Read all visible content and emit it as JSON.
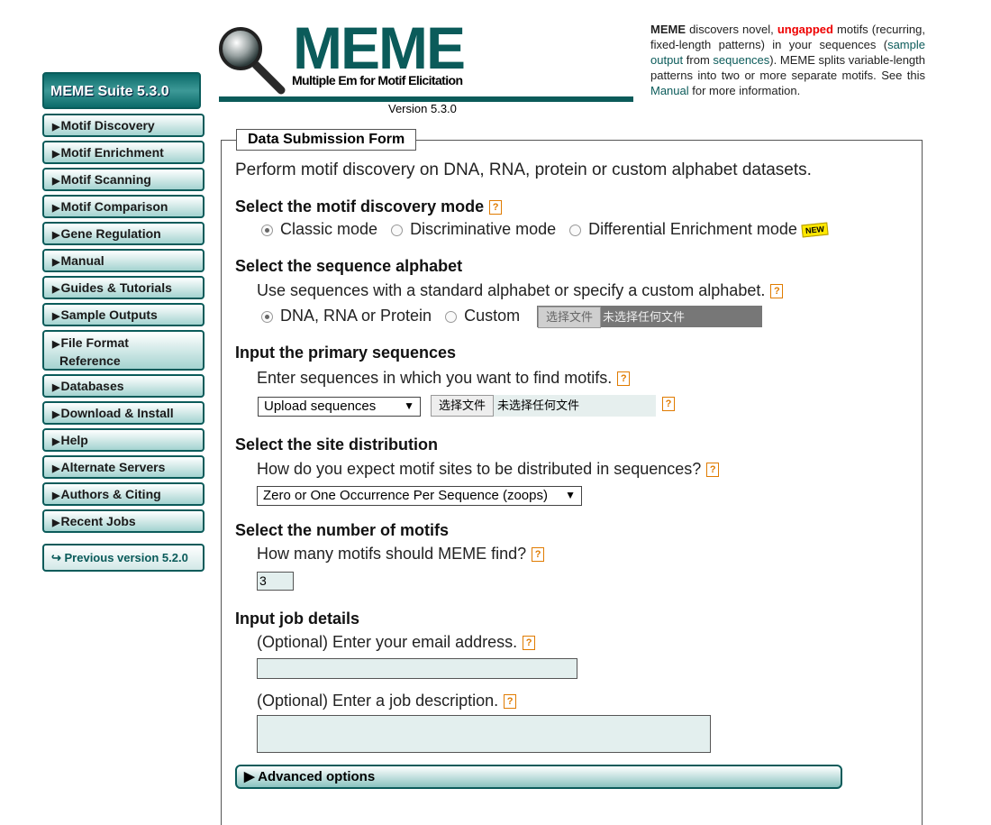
{
  "suite": {
    "label": "MEME Suite 5.3.0"
  },
  "nav": {
    "items": [
      "Motif Discovery",
      "Motif Enrichment",
      "Motif Scanning",
      "Motif Comparison",
      "Gene Regulation",
      "Manual",
      "Guides & Tutorials",
      "Sample Outputs",
      "File Format",
      "Reference",
      "Databases",
      "Download & Install",
      "Help",
      "Alternate Servers",
      "Authors & Citing",
      "Recent Jobs"
    ],
    "previous": "↪ Previous version 5.2.0"
  },
  "header": {
    "logo_title": "MEME",
    "logo_subtitle": "Multiple Em for Motif Elicitation",
    "version": "Version 5.3.0"
  },
  "intro": {
    "p1": "MEME",
    "p2": " discovers novel, ",
    "p3": "ungapped",
    "p4": " motifs (recurring, fixed-length patterns) in your sequences (",
    "link1": "sample output",
    "p5": " from ",
    "link2": "sequences",
    "p6": "). MEME splits variable-length patterns into two or more separate motifs. See this ",
    "link3": "Manual",
    "p7": " for more information."
  },
  "form": {
    "legend": "Data Submission Form",
    "lead": "Perform motif discovery on DNA, RNA, protein or custom alphabet datasets.",
    "mode": {
      "heading": "Select the motif discovery mode",
      "options": [
        "Classic mode",
        "Discriminative mode",
        "Differential Enrichment mode"
      ],
      "selected": "Classic mode",
      "new_badge": "NEW"
    },
    "alphabet": {
      "heading": "Select the sequence alphabet",
      "prompt": "Use sequences with a standard alphabet or specify a custom alphabet.",
      "options": [
        "DNA, RNA or Protein",
        "Custom"
      ],
      "selected": "DNA, RNA or Protein",
      "file_button": "选择文件",
      "file_status": "未选择任何文件"
    },
    "primary": {
      "heading": "Input the primary sequences",
      "prompt": "Enter sequences in which you want to find motifs.",
      "select_value": "Upload sequences",
      "file_button": "选择文件",
      "file_status": "未选择任何文件"
    },
    "distribution": {
      "heading": "Select the site distribution",
      "prompt": "How do you expect motif sites to be distributed in sequences?",
      "select_value": "Zero or One Occurrence Per Sequence (zoops)"
    },
    "motifs": {
      "heading": "Select the number of motifs",
      "prompt": "How many motifs should MEME find?",
      "value": "3"
    },
    "job": {
      "heading": "Input job details",
      "email_prompt": "(Optional) Enter your email address.",
      "email_value": "",
      "desc_prompt": "(Optional) Enter a job description.",
      "desc_value": ""
    },
    "advanced": "Advanced options"
  },
  "icons": {
    "help": "help-icon",
    "magnifier": "magnifying-glass-icon",
    "arrow": "triangle-right-icon"
  },
  "colors": {
    "teal": "#0b5b5a",
    "red_highlight": "#ee0000",
    "help_orange": "#e07b00"
  }
}
